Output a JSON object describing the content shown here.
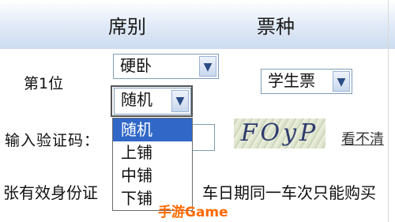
{
  "header": {
    "seat_col": "席别",
    "ticket_col": "票种"
  },
  "row": {
    "label": "第1位",
    "seat_class": "硬卧",
    "berth": "随机",
    "ticket_type": "学生票"
  },
  "berth_options": [
    "随机",
    "上铺",
    "中铺",
    "下铺"
  ],
  "verify": {
    "label": "输入验证码：",
    "captcha_text": "FOyP",
    "refresh_link": "看不清"
  },
  "notice": {
    "left": "张有效身份证",
    "right": "车日期同一车次只能购买"
  },
  "watermark": "手游Game",
  "colors": {
    "selected_bg": "#3168c8",
    "watermark": "#ff6a00"
  }
}
